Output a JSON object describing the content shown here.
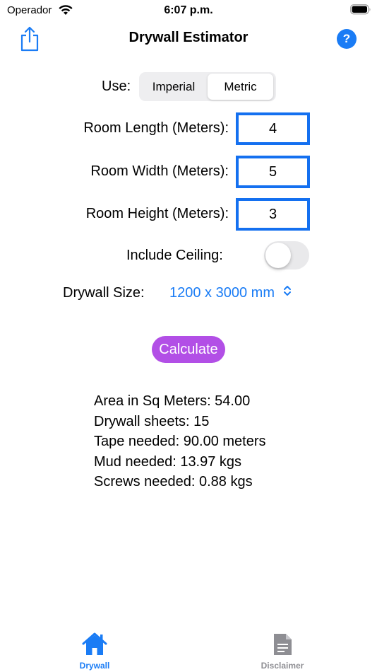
{
  "status_bar": {
    "carrier": "Operador",
    "time": "6:07 p.m."
  },
  "nav": {
    "title": "Drywall Estimator",
    "help_label": "?"
  },
  "units": {
    "label": "Use:",
    "options": [
      "Imperial",
      "Metric"
    ],
    "selected": "Metric"
  },
  "inputs": {
    "length_label": "Room Length (Meters):",
    "length_value": "4",
    "width_label": "Room Width (Meters):",
    "width_value": "5",
    "height_label": "Room Height (Meters):",
    "height_value": "3"
  },
  "ceiling": {
    "label": "Include Ceiling:",
    "on": false
  },
  "drywall_size": {
    "label": "Drywall Size:",
    "value": "1200 x 3000 mm"
  },
  "calculate_label": "Calculate",
  "results": [
    "Area in Sq Meters: 54.00",
    "Drywall sheets: 15",
    "Tape needed: 90.00 meters",
    "Mud needed: 13.97 kgs",
    "Screws needed: 0.88 kgs"
  ],
  "tabs": [
    {
      "label": "Drywall",
      "icon": "house-icon",
      "active": true
    },
    {
      "label": "Disclaimer",
      "icon": "document-icon",
      "active": false
    }
  ],
  "colors": {
    "accent": "#1a7cf5",
    "field_border": "#1470f0",
    "calculate_button": "#b24fe6",
    "inactive_tab": "#8e8e93"
  }
}
